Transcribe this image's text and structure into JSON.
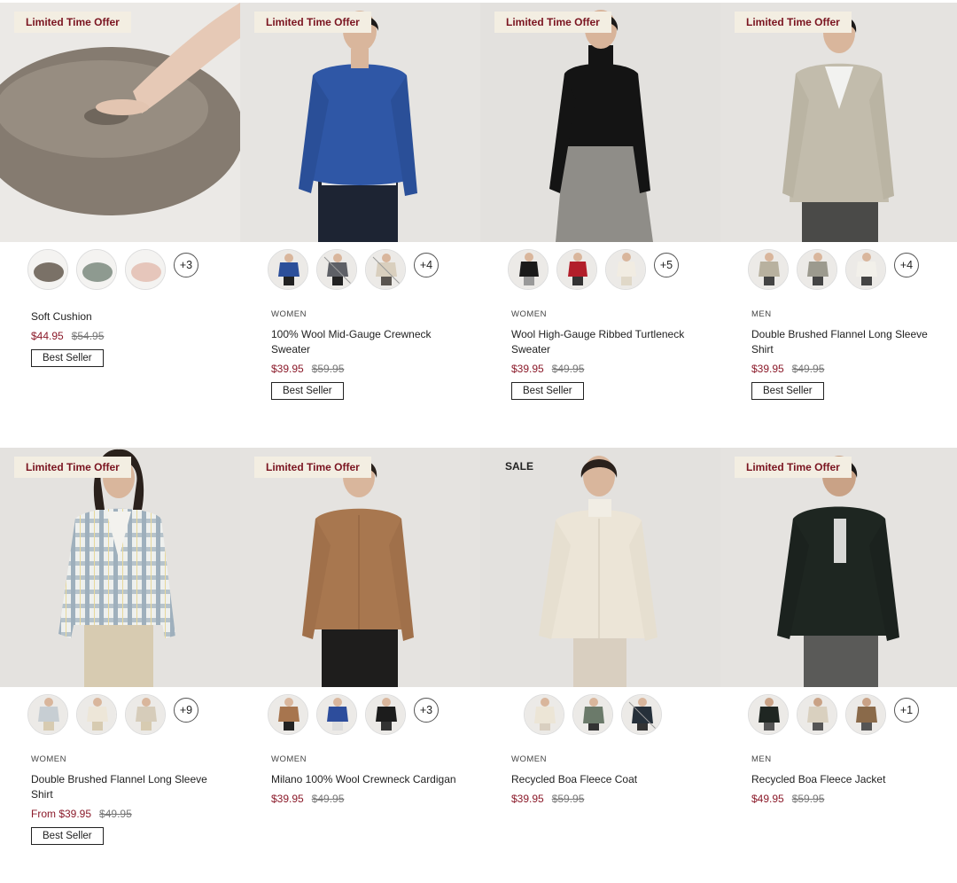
{
  "colors": {
    "accent": "#8b1a2a",
    "badge_bg": "#f3eee2",
    "badge_text": "#7a1420"
  },
  "products": [
    {
      "badge": "Limited Time Offer",
      "badge_type": "offer",
      "image": "soft-cushion-image",
      "swatches": [
        "#7a7167",
        "#8e9a90",
        "#e6c6bb"
      ],
      "more": "+3",
      "gender": "",
      "name": "Soft Cushion",
      "price": "$44.95",
      "was": "$54.95",
      "best_seller": "Best Seller"
    },
    {
      "badge": "Limited Time Offer",
      "badge_type": "offer",
      "image": "wool-crewneck-sweater-image",
      "swatches": [
        "#2c4f9a",
        "#5e6066",
        "#d9cfbe"
      ],
      "more": "+4",
      "gender": "WOMEN",
      "name": "100% Wool Mid-Gauge Crewneck Sweater",
      "price": "$39.95",
      "was": "$59.95",
      "best_seller": "Best Seller"
    },
    {
      "badge": "Limited Time Offer",
      "badge_type": "offer",
      "image": "turtleneck-sweater-image",
      "swatches": [
        "#1a1a1a",
        "#b21e2a",
        "#ece6da"
      ],
      "more": "+5",
      "gender": "WOMEN",
      "name": "Wool High-Gauge Ribbed Turtleneck Sweater",
      "price": "$39.95",
      "was": "$49.95",
      "best_seller": "Best Seller"
    },
    {
      "badge": "Limited Time Offer",
      "badge_type": "offer",
      "image": "flannel-shirt-men-image",
      "swatches": [
        "#b8b19f",
        "#9c9a8e",
        "#f2f0ea"
      ],
      "more": "+4",
      "gender": "MEN",
      "name": "Double Brushed Flannel Long Sleeve Shirt",
      "price": "$39.95",
      "was": "$49.95",
      "best_seller": "Best Seller"
    },
    {
      "badge": "Limited Time Offer",
      "badge_type": "offer",
      "image": "plaid-flannel-shirt-women-image",
      "swatches": [
        "#c7ced3",
        "#ede6d8",
        "#d6ccba"
      ],
      "more": "+9",
      "gender": "WOMEN",
      "name": "Double Brushed Flannel Long Sleeve Shirt",
      "price": "From $39.95",
      "was": "$49.95",
      "best_seller": "Best Seller"
    },
    {
      "badge": "Limited Time Offer",
      "badge_type": "offer",
      "image": "milano-cardigan-image",
      "swatches": [
        "#a7754e",
        "#2d4d9c",
        "#1c1c1c"
      ],
      "more": "+3",
      "gender": "WOMEN",
      "name": "Milano 100% Wool Crewneck Cardigan",
      "price": "$39.95",
      "was": "$49.95",
      "best_seller": ""
    },
    {
      "badge": "SALE",
      "badge_type": "sale",
      "image": "boa-fleece-coat-image",
      "swatches": [
        "#ece5d6",
        "#6b7a6a",
        "#26303a"
      ],
      "more": "",
      "gender": "WOMEN",
      "name": "Recycled Boa Fleece Coat",
      "price": "$39.95",
      "was": "$59.95",
      "best_seller": ""
    },
    {
      "badge": "Limited Time Offer",
      "badge_type": "offer",
      "image": "boa-fleece-jacket-image",
      "swatches": [
        "#1f2622",
        "#d9d0bf",
        "#8a6a4a"
      ],
      "more": "+1",
      "gender": "MEN",
      "name": "Recycled Boa Fleece Jacket",
      "price": "$49.95",
      "was": "$59.95",
      "best_seller": ""
    }
  ]
}
